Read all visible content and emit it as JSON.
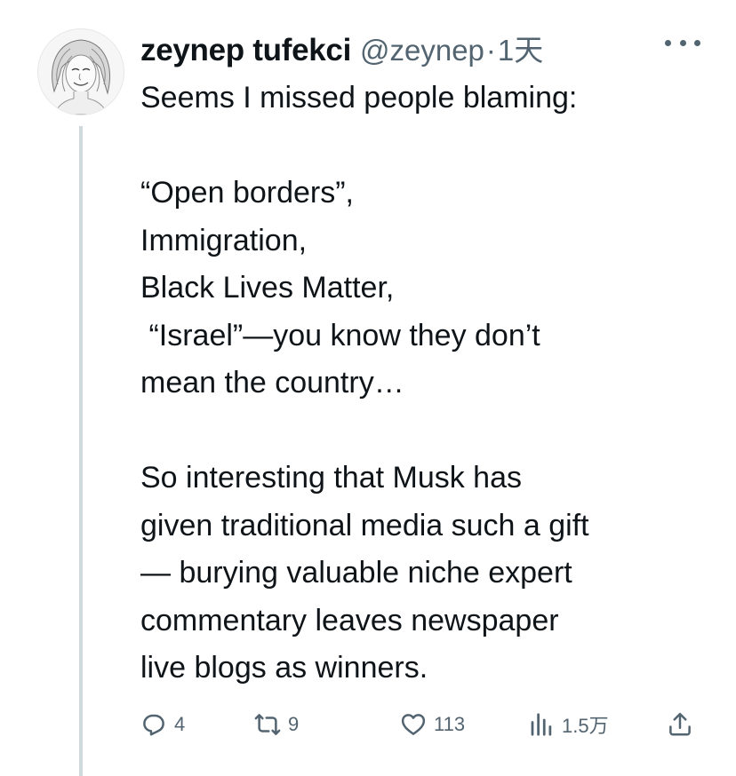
{
  "author": {
    "name": "zeynep tufekci",
    "handle": "@zeynep",
    "separator": "·",
    "time": "1天"
  },
  "tweet_lines": [
    "Seems I missed people blaming:",
    "",
    "“Open borders”,",
    "Immigration,",
    "Black Lives Matter,",
    " “Israel”—you know they don’t",
    "mean the country…",
    "",
    "So interesting that Musk has",
    "given traditional media such a gift",
    "— burying valuable niche expert",
    "commentary leaves newspaper",
    "live blogs as winners."
  ],
  "actions": {
    "replies": "4",
    "retweets": "9",
    "likes": "113",
    "views": "1.5万"
  },
  "icons": {
    "more": "more-horizontal-icon",
    "reply": "reply-bubble-icon",
    "retweet": "retweet-icon",
    "like": "heart-icon",
    "views": "analytics-bars-icon",
    "share": "share-upload-icon"
  },
  "colors": {
    "text": "#0f1419",
    "secondary": "#536471",
    "thread_line": "#cfd9de"
  }
}
